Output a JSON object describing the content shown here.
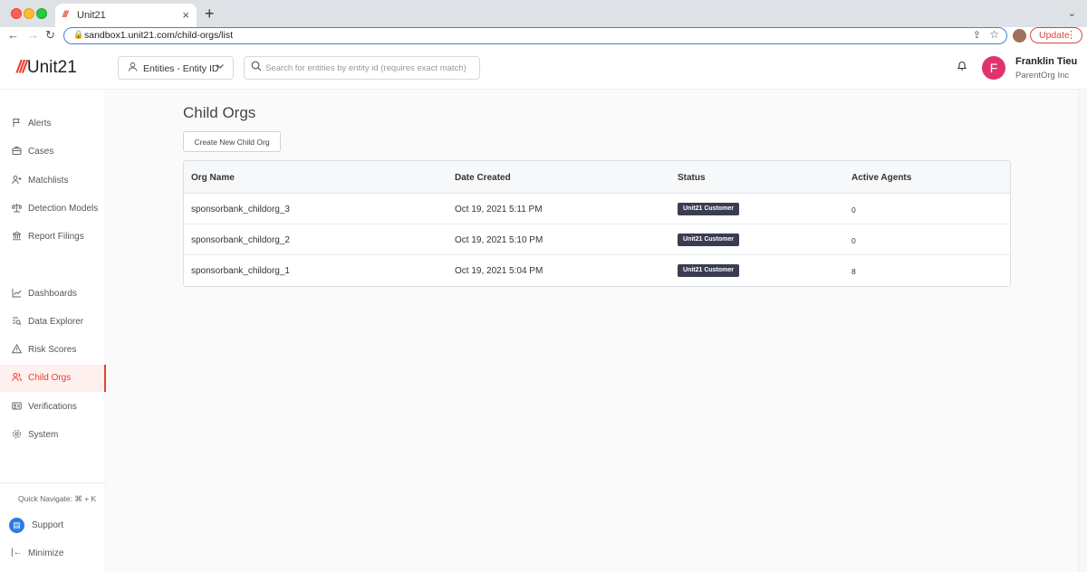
{
  "browser": {
    "tab_title": "Unit21",
    "tab_favicon": "///",
    "url": "sandbox1.unit21.com/child-orgs/list",
    "update_label": "Update"
  },
  "header": {
    "logo_mark": "///",
    "logo_text": "Unit21",
    "entity_select": "Entities - Entity ID",
    "search_placeholder": "Search for entities by entity id (requires exact match)",
    "user_initial": "F",
    "user_name": "Franklin Tieu",
    "user_org": "ParentOrg Inc"
  },
  "sidebar": {
    "items": [
      {
        "label": "Alerts",
        "icon": "flag-icon"
      },
      {
        "label": "Cases",
        "icon": "briefcase-icon"
      },
      {
        "label": "Matchlists",
        "icon": "user-plus-icon"
      },
      {
        "label": "Detection Models",
        "icon": "scale-icon"
      },
      {
        "label": "Report Filings",
        "icon": "bank-icon"
      },
      {
        "label": "Dashboards",
        "icon": "chart-line-icon"
      },
      {
        "label": "Data Explorer",
        "icon": "search-list-icon"
      },
      {
        "label": "Risk Scores",
        "icon": "warning-icon"
      },
      {
        "label": "Child Orgs",
        "icon": "users-icon"
      },
      {
        "label": "Verifications",
        "icon": "id-card-icon"
      },
      {
        "label": "System",
        "icon": "gear-icon"
      }
    ],
    "quick_navigate": "Quick Navigate: ⌘ + K",
    "support": "Support",
    "minimize": "Minimize"
  },
  "main": {
    "title": "Child Orgs",
    "create_button": "Create New Child Org",
    "columns": [
      "Org Name",
      "Date Created",
      "Status",
      "Active Agents"
    ],
    "rows": [
      {
        "name": "sponsorbank_childorg_3",
        "date": "Oct 19, 2021 5:11 PM",
        "status": "Unit21 Customer",
        "agents": "0"
      },
      {
        "name": "sponsorbank_childorg_2",
        "date": "Oct 19, 2021 5:10 PM",
        "status": "Unit21 Customer",
        "agents": "0"
      },
      {
        "name": "sponsorbank_childorg_1",
        "date": "Oct 19, 2021 5:04 PM",
        "status": "Unit21 Customer",
        "agents": "8"
      }
    ]
  }
}
